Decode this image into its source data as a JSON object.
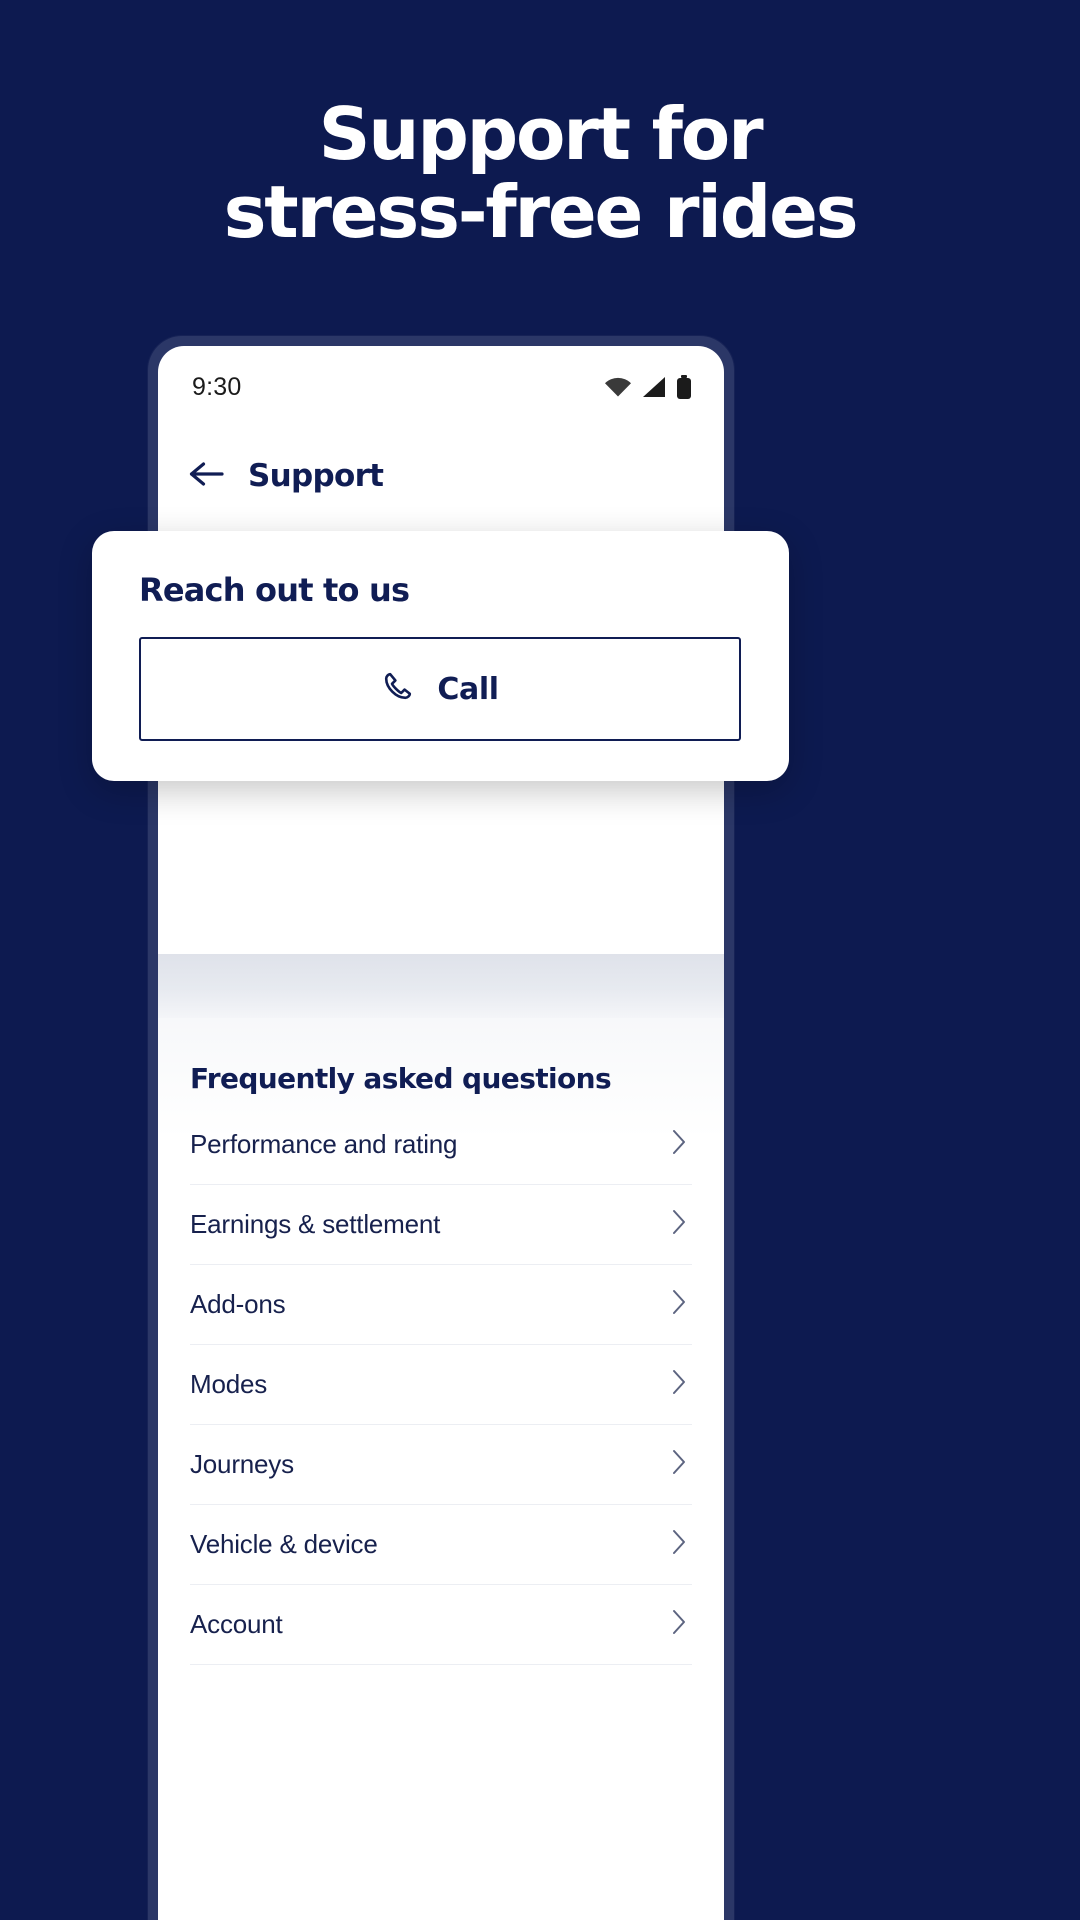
{
  "promo": {
    "headline_line1": "Support for",
    "headline_line2": "stress-free rides",
    "background_color": "#0d1a50",
    "text_color": "#ffffff"
  },
  "phone": {
    "status_bar": {
      "time": "9:30",
      "icons": [
        "wifi-icon",
        "cellular-signal-icon",
        "battery-icon"
      ]
    },
    "app_bar": {
      "back_icon": "arrow-left-icon",
      "title": "Support"
    }
  },
  "reach_card": {
    "title": "Reach out to us",
    "call_button": {
      "icon": "phone-handset-icon",
      "label": "Call"
    }
  },
  "faq": {
    "title": "Frequently asked questions",
    "chevron_icon": "chevron-right-icon",
    "items": [
      {
        "label": "Performance and rating"
      },
      {
        "label": "Earnings & settlement"
      },
      {
        "label": "Add-ons"
      },
      {
        "label": "Modes"
      },
      {
        "label": "Journeys"
      },
      {
        "label": "Vehicle & device"
      },
      {
        "label": "Account"
      }
    ]
  },
  "colors": {
    "brand_navy": "#101d54",
    "promo_bg": "#0d1a50",
    "phone_bezel": "#2b3767",
    "divider": "#eceef3"
  }
}
